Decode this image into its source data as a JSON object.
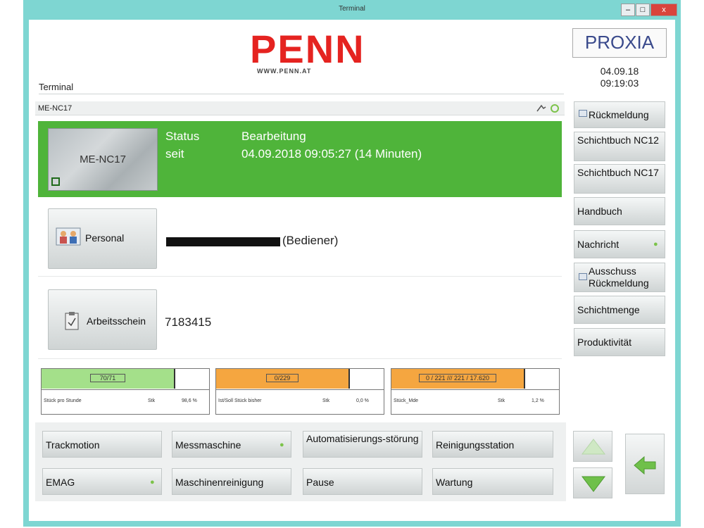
{
  "window": {
    "title": "Terminal",
    "controls": {
      "minimize": "–",
      "maximize": "□",
      "close": "x"
    }
  },
  "brand": {
    "logo": "PENN",
    "url": "WWW.PENN.AT",
    "vendor": "PROXIA"
  },
  "datetime": {
    "date": "04.09.18",
    "time": "09:19:03"
  },
  "header": {
    "terminal_label": "Terminal",
    "machine_id": "ME-NC17"
  },
  "status": {
    "machine_label": "ME-NC17",
    "status_label": "Status",
    "status_value": "Bearbeitung",
    "since_label": "seit",
    "since_value": "04.09.2018 09:05:27 (14 Minuten)",
    "color": "#4fb43a"
  },
  "personal": {
    "button_label": "Personal",
    "value_suffix": "(Bediener)"
  },
  "arbeitsschein": {
    "button_label": "Arbeitsschein",
    "value": "7183415"
  },
  "gauges": [
    {
      "top": "70/71",
      "label": "Stück pro Stunde",
      "unit": "Stk",
      "percent": "98,6 %",
      "fill": 1.0,
      "color": "#a4e08a"
    },
    {
      "top": "0/229",
      "label": "Ist/Soll Stück bisher",
      "unit": "Stk",
      "percent": "0,0 %",
      "fill": 1.0,
      "color": "#f5a640"
    },
    {
      "top": "0 / 221 /// 221 / 17.620",
      "label": "Stück_Mde",
      "unit": "Stk",
      "percent": "1,2 %",
      "fill": 1.0,
      "color": "#f5a640"
    }
  ],
  "sidebar": {
    "items": [
      {
        "label": "Rückmeldung",
        "icon": "document-icon"
      },
      {
        "label": "Schichtbuch NC12"
      },
      {
        "label": "Schichtbuch NC17"
      },
      {
        "label": "Handbuch"
      },
      {
        "label": "Nachricht",
        "dot": "●"
      },
      {
        "label": "Ausschuss Rückmeldung",
        "icon": "document-icon"
      },
      {
        "label": "Schichtmenge"
      },
      {
        "label": "Produktivität"
      }
    ]
  },
  "bottom": {
    "row1": [
      {
        "label": "Trackmotion"
      },
      {
        "label": "Messmaschine",
        "dot": "●"
      },
      {
        "label": "Automatisierungs-störung"
      },
      {
        "label": "Reinigungsstation"
      }
    ],
    "row2": [
      {
        "label": "EMAG",
        "dot": "●"
      },
      {
        "label": "Maschinenreinigung"
      },
      {
        "label": "Pause"
      },
      {
        "label": "Wartung"
      }
    ]
  }
}
